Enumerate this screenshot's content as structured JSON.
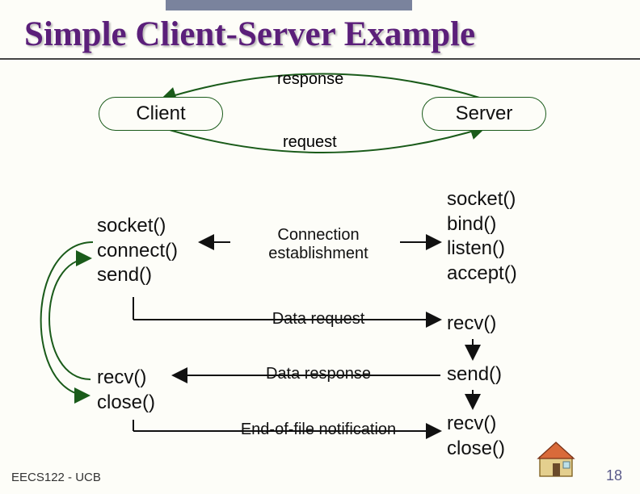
{
  "title": "Simple Client-Server Example",
  "clientNode": "Client",
  "serverNode": "Server",
  "responseLabel": "response",
  "requestLabel": "request",
  "clientStep1": [
    "socket()",
    "connect()",
    "send()"
  ],
  "clientStep2": [
    "recv()",
    "close()"
  ],
  "serverStep1": [
    "socket()",
    "bind()",
    "listen()",
    "accept()"
  ],
  "serverStep2": "recv()",
  "serverStep3": "send()",
  "serverStep4": [
    "recv()",
    "close()"
  ],
  "midLabels": {
    "conn": [
      "Connection",
      "establishment"
    ],
    "dataReq": "Data request",
    "dataResp": "Data response",
    "eof": "End-of-file notification"
  },
  "footer": {
    "left": "EECS122 - UCB",
    "slide": "18"
  }
}
